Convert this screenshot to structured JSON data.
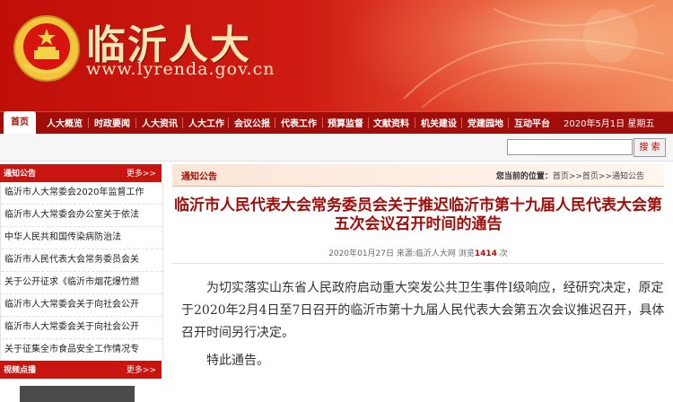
{
  "header": {
    "site_name": "临沂人大",
    "site_url": "www.lyrenda.gov.cn",
    "emblem_icon": "national-emblem-icon",
    "colors": {
      "banner": "#c00f09",
      "title_text": "#f7e7b4",
      "nav": "#a10e0a"
    }
  },
  "nav": {
    "home": "首页",
    "items": [
      "人大概览",
      "时政要闻",
      "人大资讯",
      "人大工作",
      "会议公报",
      "代表工作",
      "预算监督",
      "文献资料",
      "机关建设",
      "党建园地",
      "互动平台"
    ],
    "date": "2020年5月1日 星期五"
  },
  "search": {
    "placeholder": "",
    "button_label": "搜 索"
  },
  "sidebar": {
    "notices_title": "通知公告",
    "notices_more": "更多>>",
    "notices": [
      "临沂市人大常委会2020年监督工作",
      "临沂市人大常委会办公室关于依法",
      "中华人民共和国传染病防治法",
      "临沂市人民代表大会常务委员会关",
      "关于公开征求《临沂市烟花爆竹燃",
      "临沂市人大常委会关于向社会公开",
      "临沂市人大常委会关于向社会公开",
      "关于征集全市食品安全工作情况专"
    ],
    "video_title": "视频点播",
    "video_more": "更多>>"
  },
  "content": {
    "tab": "通知公告",
    "breadcrumb_label": "您当前的位置：",
    "breadcrumb_path": "首页>>首页>>通知公告",
    "title": "临沂市人民代表大会常务委员会关于推迟临沂市第十九届人民代表大会第五次会议召开时间的通告",
    "meta": {
      "date": "2020年01月27日",
      "source": "来源:临沂人大网",
      "views_label": "浏览",
      "views": "1414",
      "views_unit": "次"
    },
    "body": "为切实落实山东省人民政府启动重大突发公共卫生事件Ⅰ级响应，经研究决定，原定于2020年2月4日至7日召开的临沂市第十九届人民代表大会第五次会议推迟召开，具体召开时间另行决定。",
    "closing": "特此通告。"
  }
}
